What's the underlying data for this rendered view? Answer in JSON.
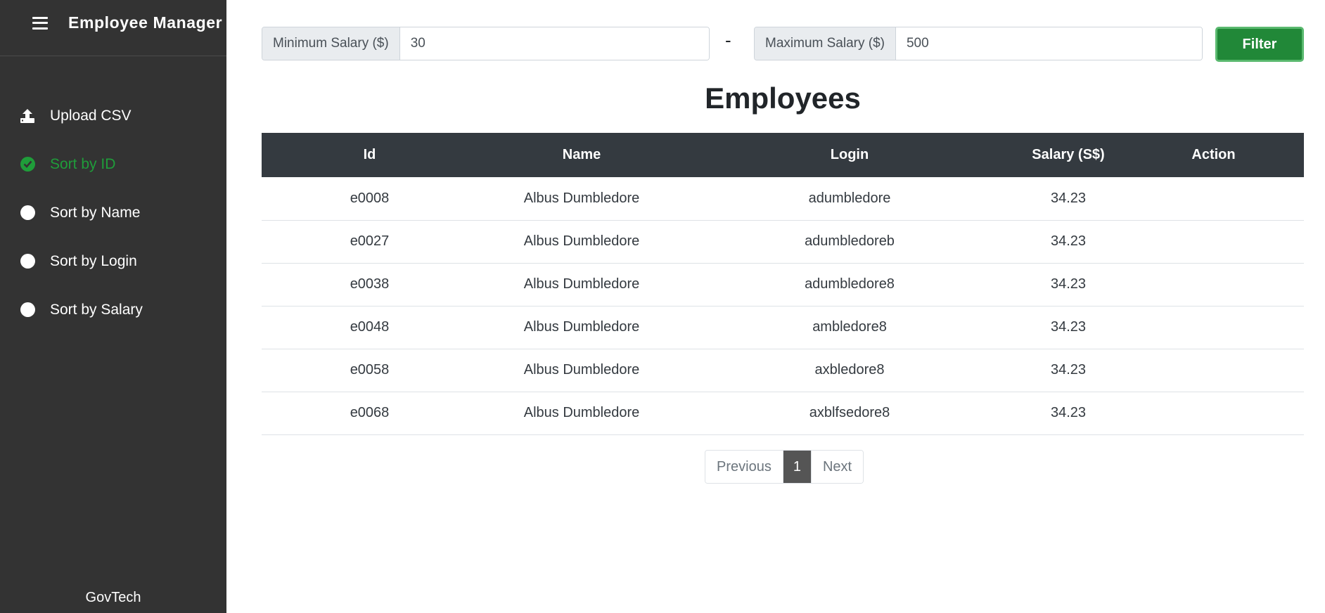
{
  "app": {
    "title": "Employee Manager",
    "footer": "GovTech"
  },
  "sidebar": {
    "items": [
      {
        "label": "Upload CSV",
        "icon": "upload-icon",
        "active": false
      },
      {
        "label": "Sort by ID",
        "icon": "check-circle-icon",
        "active": true
      },
      {
        "label": "Sort by Name",
        "icon": "radio-icon",
        "active": false
      },
      {
        "label": "Sort by Login",
        "icon": "radio-icon",
        "active": false
      },
      {
        "label": "Sort by Salary",
        "icon": "radio-icon",
        "active": false
      }
    ]
  },
  "filter": {
    "min_label": "Minimum Salary ($)",
    "min_value": "30",
    "separator": "-",
    "max_label": "Maximum Salary ($)",
    "max_value": "500",
    "button_label": "Filter"
  },
  "main": {
    "title": "Employees"
  },
  "table": {
    "headers": [
      "Id",
      "Name",
      "Login",
      "Salary (S$)",
      "Action"
    ],
    "rows": [
      {
        "id": "e0008",
        "name": "Albus Dumbledore",
        "login": "adumbledore",
        "salary": "34.23",
        "action": ""
      },
      {
        "id": "e0027",
        "name": "Albus Dumbledore",
        "login": "adumbledoreb",
        "salary": "34.23",
        "action": ""
      },
      {
        "id": "e0038",
        "name": "Albus Dumbledore",
        "login": "adumbledore8",
        "salary": "34.23",
        "action": ""
      },
      {
        "id": "e0048",
        "name": "Albus Dumbledore",
        "login": "ambledore8",
        "salary": "34.23",
        "action": ""
      },
      {
        "id": "e0058",
        "name": "Albus Dumbledore",
        "login": "axbledore8",
        "salary": "34.23",
        "action": ""
      },
      {
        "id": "e0068",
        "name": "Albus Dumbledore",
        "login": "axblfsedore8",
        "salary": "34.23",
        "action": ""
      }
    ]
  },
  "pagination": {
    "previous": "Previous",
    "current": "1",
    "next": "Next"
  },
  "colors": {
    "sidebar_bg": "#333333",
    "accent_green": "#1f9d3a",
    "table_header_bg": "#343a40",
    "filter_button": "#218838"
  }
}
